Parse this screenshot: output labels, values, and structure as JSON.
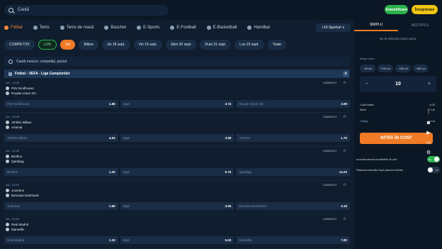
{
  "header": {
    "search_placeholder": "Caută",
    "login_label": "Autentificare",
    "register_label": "Înregistrare"
  },
  "sports": [
    {
      "label": "Fotbal",
      "active": true
    },
    {
      "label": "Tenis",
      "active": false
    },
    {
      "label": "Tenis de masă",
      "active": false
    },
    {
      "label": "Baschet",
      "active": false
    },
    {
      "label": "E-Sports",
      "active": false
    },
    {
      "label": "E-Football",
      "active": false
    },
    {
      "label": "E-Basketball",
      "active": false
    },
    {
      "label": "Handbal",
      "active": false
    }
  ],
  "sports_more": "+16 Sporturi ∨",
  "filters": [
    "COMPETIȚII",
    "LIVE",
    "Azi",
    "Mâine",
    "Joi 18 sept.",
    "Vin 19 sept.",
    "Sâm 20 sept.",
    "Dum 21 sept.",
    "Lun 22 sept.",
    "Toate"
  ],
  "event_search_placeholder": "Caută meciuri, competiții, pariuri",
  "competition": "Fotbal - UEFA - Liga Campionilor",
  "matches": [
    {
      "time": "Azi - 19:45",
      "team1": "PSV Eindhoven",
      "team2": "Royale Union SG",
      "cashout": "CASHOUT",
      "odds": [
        {
          "lbl": "PSV Eindhoven",
          "val": "1.88"
        },
        {
          "lbl": "Egal",
          "val": "3.74"
        },
        {
          "lbl": "Royale Union SG",
          "val": "3.99"
        }
      ]
    },
    {
      "time": "Azi - 19:45",
      "team1": "Athletic Bilbao",
      "team2": "Arsenal",
      "cashout": "CASHOUT",
      "odds": [
        {
          "lbl": "Athletic Bilbao",
          "val": "4.94"
        },
        {
          "lbl": "Egal",
          "val": "3.58"
        },
        {
          "lbl": "Arsenal",
          "val": "1.75"
        }
      ]
    },
    {
      "time": "Azi - 22:00",
      "team1": "Benfica",
      "team2": "Qarabag",
      "cashout": "CASHOUT",
      "odds": [
        {
          "lbl": "Benfica",
          "val": "1.20"
        },
        {
          "lbl": "Egal",
          "val": "6.75"
        },
        {
          "lbl": "Qarabag",
          "val": "13.22"
        }
      ]
    },
    {
      "time": "Azi - 22:00",
      "team1": "Juventus",
      "team2": "Borussia Dortmund",
      "cashout": "CASHOUT",
      "odds": [
        {
          "lbl": "Juventus",
          "val": "1.66"
        },
        {
          "lbl": "Egal",
          "val": "3.56"
        },
        {
          "lbl": "Borussia Dortmund",
          "val": "4.16"
        }
      ]
    },
    {
      "time": "Azi - 22:00",
      "team1": "Real Madrid",
      "team2": "Marseille",
      "cashout": "CASHOUT",
      "odds": [
        {
          "lbl": "Real Madrid",
          "val": "1.33"
        },
        {
          "lbl": "Egal",
          "val": "5.63"
        },
        {
          "lbl": "Marseille",
          "val": "7.80"
        }
      ]
    }
  ],
  "betslip": {
    "tabs": [
      "SIMPLU",
      "MULTIPLU"
    ],
    "empty_message": "Nu ai selectat niciun pariu.",
    "stake_label": "Alege miza",
    "quick_stakes": [
      "+5 Lei",
      "+10 Lei",
      "+25 Lei",
      "+50 Lei"
    ],
    "stake_value": "10",
    "total_odds_label": "Cotă totală",
    "total_odds_value": "0.00",
    "stake_sum_label": "Miză",
    "stake_sum_value": "10 Lei",
    "win_label": "Câștig",
    "win_value": "0 Lei",
    "bet_button": "INTRĂ ÎN CONT",
    "accept_label": "Acceptă automat modificările de cote",
    "accept_state": "Da",
    "cashout_label": "Păstrează selecțiile după plasarea biletului",
    "cashout_state": "Nu"
  },
  "side_tools": [
    "arrow-up-icon",
    "camera-icon",
    "video-icon",
    "document-icon",
    "gear-icon"
  ]
}
